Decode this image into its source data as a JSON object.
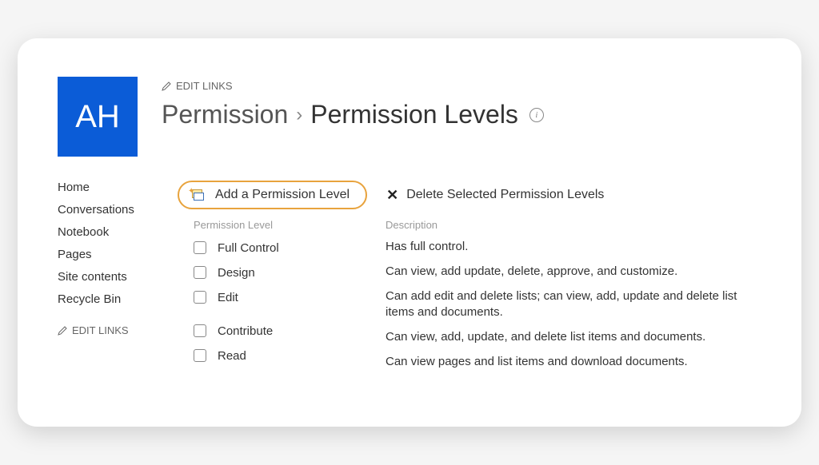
{
  "logo": {
    "initials": "AH",
    "color": "#0B5CD7"
  },
  "header": {
    "edit_links": "EDIT LINKS",
    "breadcrumb_parent": "Permission",
    "breadcrumb_current": "Permission Levels"
  },
  "sidebar": {
    "items": [
      "Home",
      "Conversations",
      "Notebook",
      "Pages",
      "Site contents",
      "Recycle Bin"
    ],
    "edit_links": "EDIT LINKS"
  },
  "toolbar": {
    "add_label": "Add a Permission Level",
    "delete_label": "Delete Selected Permission Levels"
  },
  "table": {
    "col_name_header": "Permission Level",
    "col_desc_header": "Description",
    "rows": [
      {
        "name": "Full Control",
        "desc": "Has full control."
      },
      {
        "name": "Design",
        "desc": "Can view, add update, delete, approve, and customize."
      },
      {
        "name": "Edit",
        "desc": "Can add edit and delete lists; can view, add, update and delete list items and documents."
      },
      {
        "name": "Contribute",
        "desc": "Can view, add, update, and delete list items and documents."
      },
      {
        "name": "Read",
        "desc": "Can view pages and list items and download documents."
      }
    ]
  }
}
